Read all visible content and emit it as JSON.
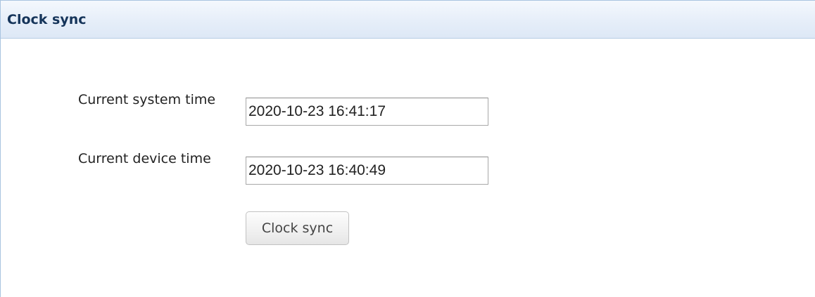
{
  "panel": {
    "title": "Clock sync"
  },
  "form": {
    "system_time": {
      "label": "Current system time",
      "value": "2020-10-23 16:41:17"
    },
    "device_time": {
      "label": "Current device time",
      "value": "2020-10-23 16:40:49"
    },
    "sync_button_label": "Clock sync"
  },
  "colors": {
    "header_background": "#e6eef9",
    "header_border": "#b5cbe4",
    "title_text": "#15345a"
  }
}
